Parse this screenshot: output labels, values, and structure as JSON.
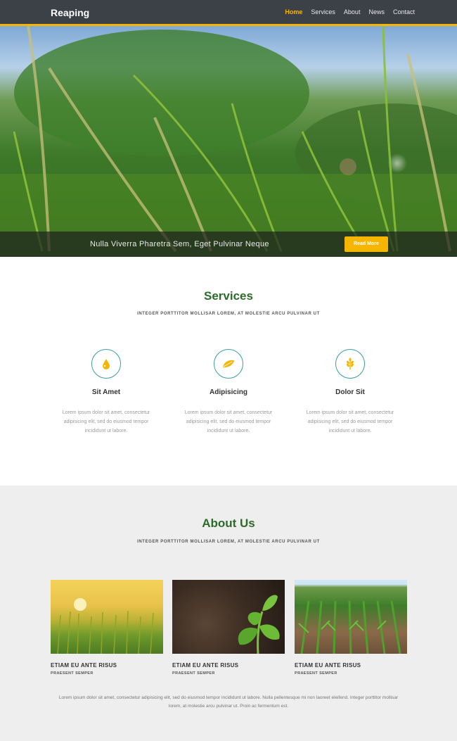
{
  "header": {
    "brand": "Reaping",
    "nav": [
      "Home",
      "Services",
      "About",
      "News",
      "Contact"
    ]
  },
  "hero": {
    "caption": "Nulla Viverra Pharetra Sem, Eget Pulvinar Neque",
    "button": "Read More"
  },
  "services": {
    "title": "Services",
    "subtitle": "INTEGER PORTTITOR MOLLISAR LOREM, AT MOLESTIE ARCU PULVINAR UT",
    "items": [
      {
        "title": "Sit Amet",
        "icon": "drop-icon",
        "text": "Lorem ipsum dolor sit amet, consectetur adipisicing elit, sed do eiusmod tempor incididunt ut labore."
      },
      {
        "title": "Adipisicing",
        "icon": "leaf-icon",
        "text": "Lorem ipsum dolor sit amet, consectetur adipisicing elit, sed do eiusmod tempor incididunt ut labore."
      },
      {
        "title": "Dolor Sit",
        "icon": "wheat-icon",
        "text": "Lorem ipsum dolor sit amet, consectetur adipisicing elit, sed do eiusmod tempor incididunt ut labore."
      }
    ]
  },
  "about": {
    "title": "About Us",
    "subtitle": "INTEGER PORTTITOR MOLLISAR LOREM, AT MOLESTIE ARCU PULVINAR UT",
    "cards": [
      {
        "title": "ETIAM EU ANTE RISUS",
        "sub": "PRAESENT SEMPER"
      },
      {
        "title": "ETIAM EU ANTE RISUS",
        "sub": "PRAESENT SEMPER"
      },
      {
        "title": "ETIAM EU ANTE RISUS",
        "sub": "PRAESENT SEMPER"
      }
    ],
    "text": "Lorem ipsum dolor sit amet, consectetur adipisicing elit, sed do eiusmod tempor incididunt ut labore. Nulla pellentesque mi non laoreet eleifend. Integer porttitor mollisar lorem, at molestie arcu pulvinar ut. Proin ac fermentum est."
  },
  "colors": {
    "accent": "#f6b600",
    "heading": "#2d6b2a",
    "header_bg": "#3c4047",
    "icon_ring": "#3a9ea1"
  }
}
